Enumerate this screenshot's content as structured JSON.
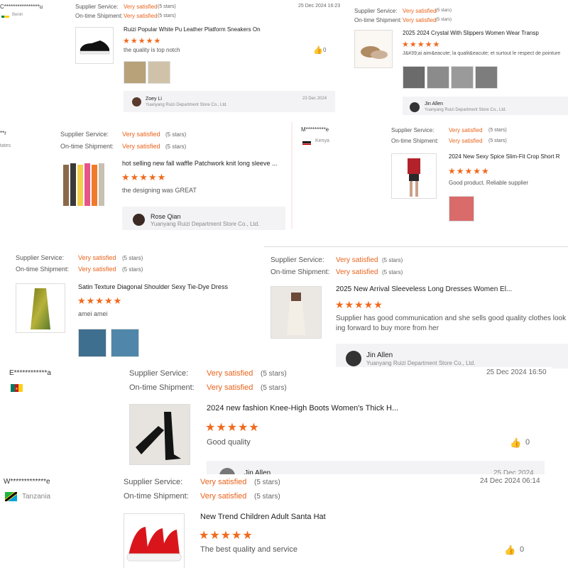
{
  "common": {
    "supplier_label": "Supplier Service:",
    "shipment_label": "On-time Shipment:",
    "rating_text": "Very satisfied",
    "stars_note": "(5 stars)",
    "star_glyphs": "★★★★★",
    "like_icon": "thumbs-up-icon"
  },
  "reviews": [
    {
      "user": "C****************u",
      "country": "Benin",
      "date": "25 Dec 2024 16:23",
      "product": "Ruizi Popular White Pu Leather Platform Sneakers On",
      "comment": "the quality is top notch",
      "likes": "0",
      "reply_name": "Zoey Li",
      "reply_store": "Yuanyang Ruizi Department Store Co., Ltd.",
      "reply_date": "23 Dec 2024"
    },
    {
      "product": "2025 2024 Crystal With Slippers Women Wear Transp",
      "comment": "J&#39;ai aim&eacute; la qualit&eacute; et surtout le respect de pointure",
      "reply_name": "Jin Allen",
      "reply_store": "Yuanyang Ruizi Department Store Co., Ltd."
    },
    {
      "user": "**r",
      "country": "tates",
      "product": "hot selling new fall waffle Patchwork knit long sleeve ...",
      "comment": "the designing was GREAT",
      "reply_name": "Rose Qian",
      "reply_store": "Yuanyang Ruizi Department Store Co., Ltd."
    },
    {
      "user": "M*********e",
      "country": "Kenya",
      "product": "2024 New Sexy Spice Slim-Fit Crop Short R",
      "comment": "Good product. Reliable supplier"
    },
    {
      "product": "Satin Texture Diagonal Shoulder Sexy Tie-Dye Dress",
      "comment": "amei amei"
    },
    {
      "product": "2025 New Arrival Sleeveless Long Dresses Women El...",
      "comment_line1": "Supplier has good communication and she sells good quality clothes look",
      "comment_line2": "ing forward to buy more from her",
      "reply_name": "Jin Allen",
      "reply_store": "Yuanyang Ruizi Department Store Co., Ltd."
    },
    {
      "user": "E************a",
      "date": "25 Dec 2024 16:50",
      "product": "2024 new fashion Knee-High Boots Women's Thick H...",
      "comment": "Good quality",
      "likes": "0",
      "reply_name": "Jin Allen",
      "reply_date": "25 Dec 2024"
    },
    {
      "user": "W*************e",
      "country": "Tanzania",
      "date": "24 Dec 2024 06:14",
      "product": "New Trend Children Adult Santa Hat",
      "comment": "The best quality and service",
      "likes": "0"
    }
  ]
}
